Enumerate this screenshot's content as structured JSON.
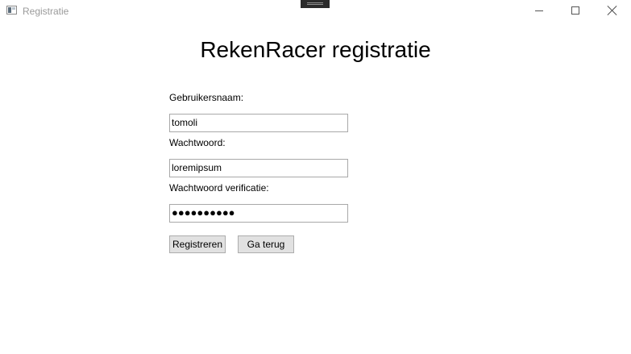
{
  "window": {
    "title": "Registratie",
    "controls": [
      "minimize-icon",
      "maximize-icon",
      "close-icon"
    ]
  },
  "page": {
    "title": "RekenRacer registratie"
  },
  "form": {
    "username_label": "Gebruikersnaam:",
    "username_value": "tomoli",
    "password_label": "Wachtwoord:",
    "password_value": "loremipsum",
    "verify_label": "Wachtwoord verificatie:",
    "verify_masked": "●●●●●●●●●●"
  },
  "buttons": {
    "register_label": "Registreren",
    "back_label": "Ga terug"
  },
  "colors": {
    "button_bg": "#e1e1e1",
    "field_border": "#a9a9a9",
    "title_text": "#9a9a9a"
  }
}
